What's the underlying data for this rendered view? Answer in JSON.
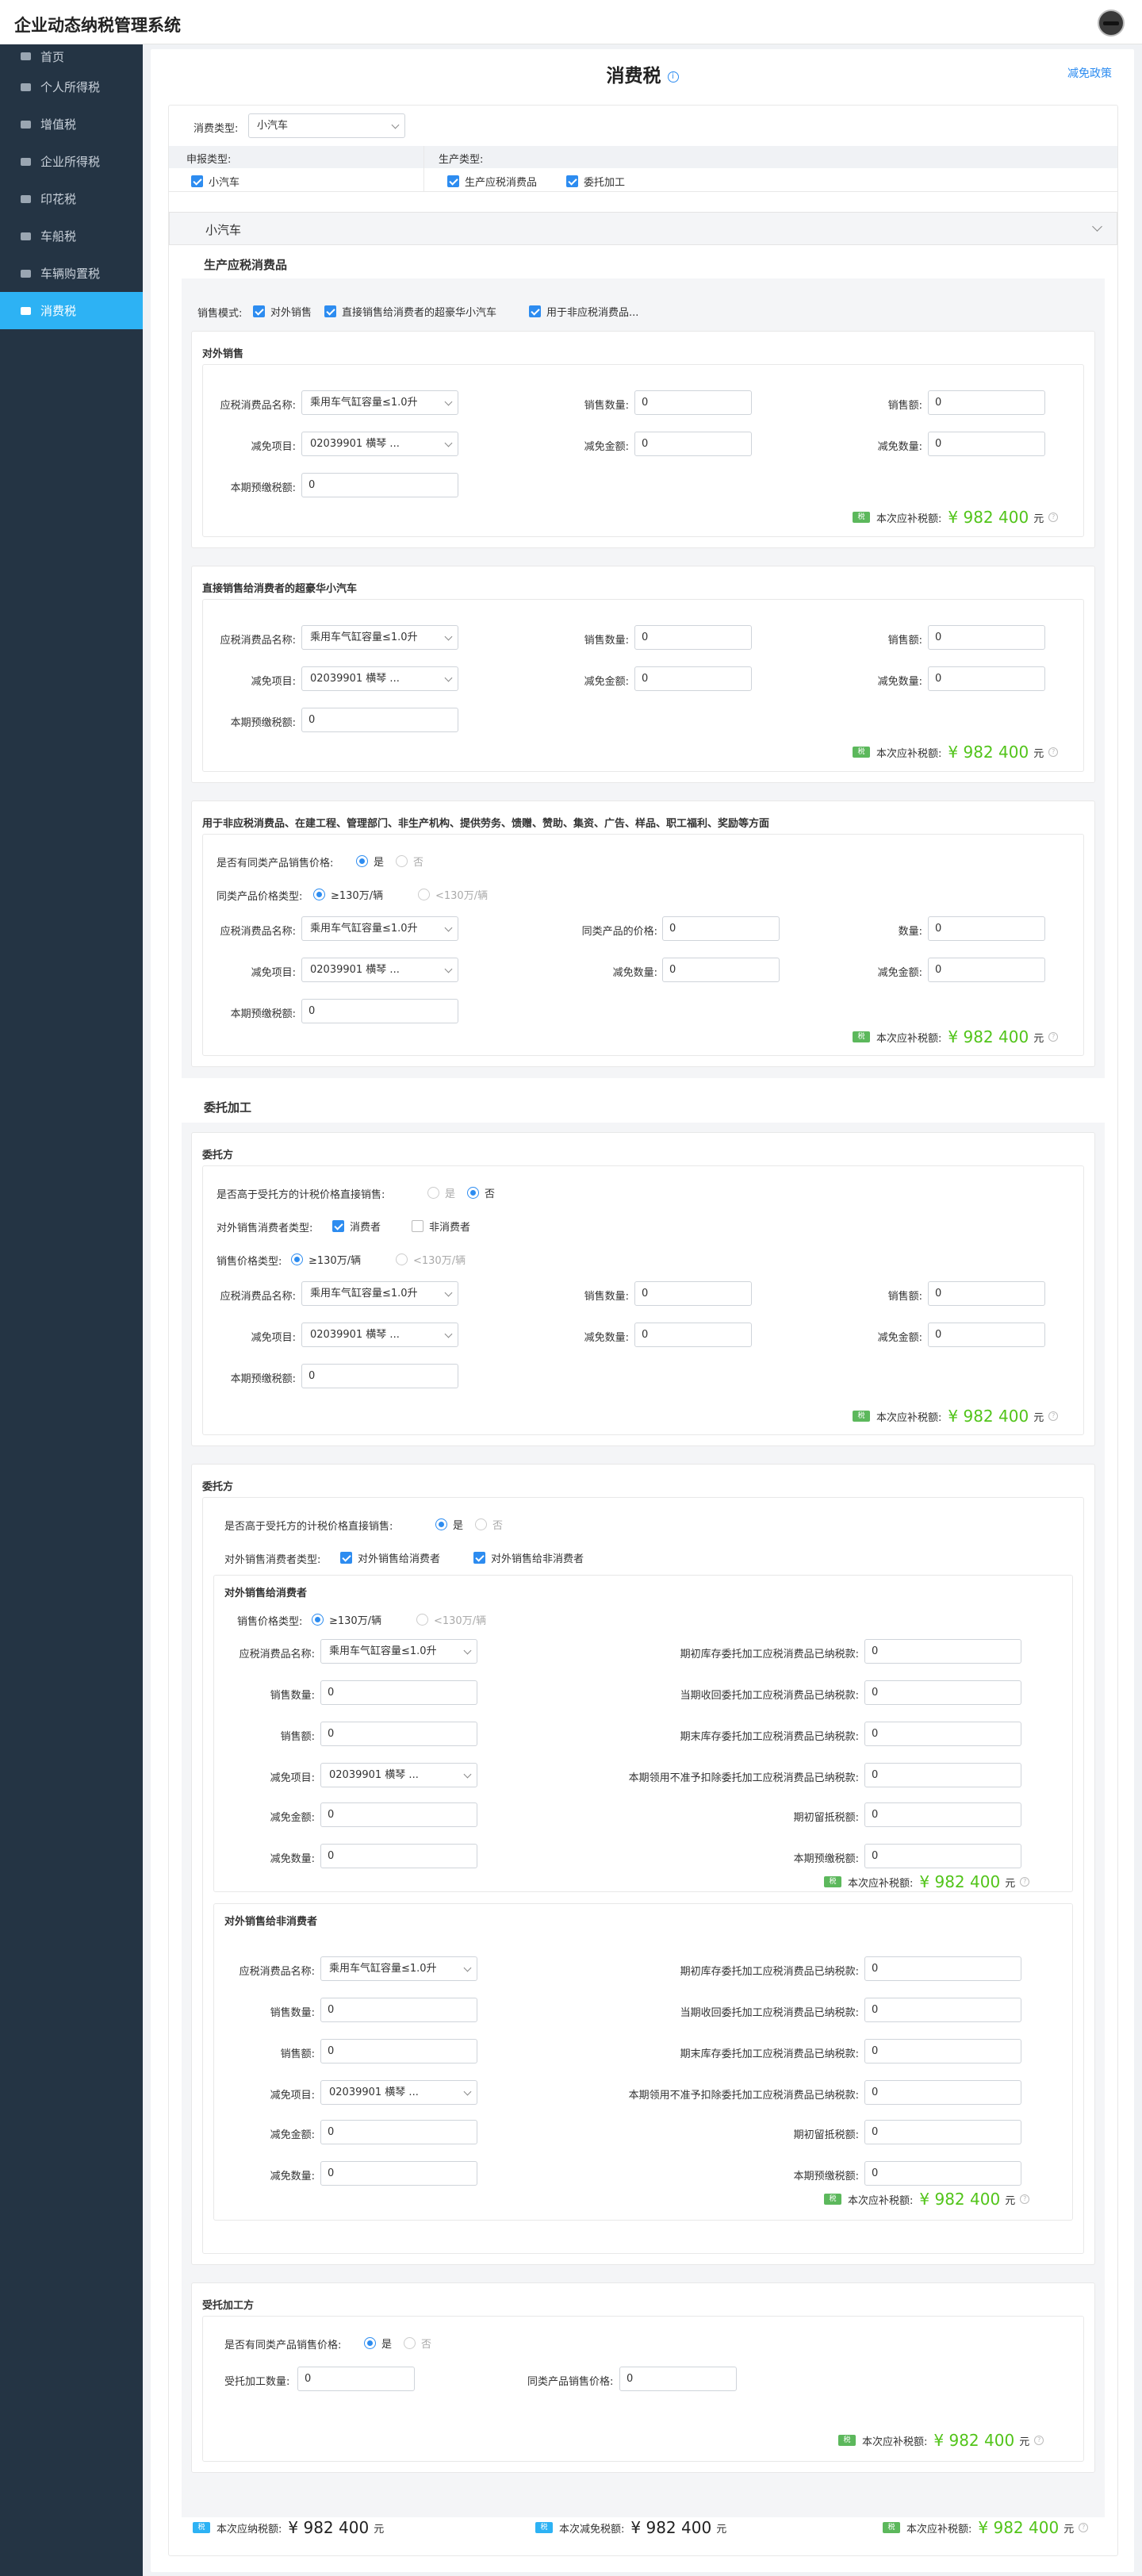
{
  "app": {
    "title": "企业动态纳税管理系统"
  },
  "sidebar": {
    "items": [
      {
        "label": "首页"
      },
      {
        "label": "个人所得税"
      },
      {
        "label": "增值税"
      },
      {
        "label": "企业所得税"
      },
      {
        "label": "印花税"
      },
      {
        "label": "车船税"
      },
      {
        "label": "车辆购置税"
      },
      {
        "label": "消费税"
      }
    ]
  },
  "page": {
    "title": "消费税",
    "policy_link": "减免政策",
    "info_glyph": "i"
  },
  "filter": {
    "type_label": "消费类型:",
    "type_value": "小汽车",
    "declare_header": "申报类型:",
    "produce_header": "生产类型:",
    "declare_option": "小汽车",
    "produce_option1": "生产应税消费品",
    "produce_option2": "委托加工"
  },
  "car_section": {
    "title": "小汽车"
  },
  "production": {
    "title": "生产应税消费品",
    "sales_mode_label": "销售模式:",
    "sales_mode_options": [
      "对外销售",
      "直接销售给消费者的超豪华小汽车",
      "用于非应税消费品..."
    ]
  },
  "labels": {
    "taxable_name": "应税消费品名称:",
    "sales_qty": "销售数量:",
    "sales_amount": "销售额:",
    "reduction_item": "减免项目:",
    "reduction_amount": "减免金额:",
    "reduction_qty": "减免数量:",
    "prepaid": "本期预缴税额:",
    "has_same_price": "是否有同类产品销售价格:",
    "same_price_type": "同类产品价格类型:",
    "same_price": "同类产品的价格:",
    "quantity": "数量:",
    "is_higher": "是否高于受托方的计税价格直接销售:",
    "consumer_type": "对外销售消费者类型:",
    "price_type": "销售价格类型:",
    "opening_stock": "期初库存委托加工应税消费品已纳税款:",
    "current_received": "当期收回委托加工应税消费品已纳税款:",
    "closing_stock": "期末库存委托加工应税消费品已纳税款:",
    "not_deductible": "本期领用不准予扣除委托加工应税消费品已纳税款:",
    "opening_retained": "期初留抵税额:",
    "processing_qty": "受托加工数量:",
    "same_product_price": "同类产品销售价格:",
    "yes": "是",
    "no": "否",
    "consumer": "消费者",
    "non_consumer": "非消费者",
    "ge130": "≥130万/辆",
    "lt130": "<130万/辆",
    "to_consumer": "对外销售给消费者",
    "to_non_consumer": "对外销售给非消费者",
    "tax_payable": "本次应补税额:",
    "yuan": "元",
    "badge": "税",
    "select_product": "乘用车气缸容量≤1.0升",
    "select_reduction": "02039901 横琴 ..."
  },
  "values": {
    "zero": "0",
    "amount": "982 400",
    "yen": "¥"
  },
  "external_sales": {
    "title": "对外销售"
  },
  "luxury": {
    "title": "直接销售给消费者的超豪华小汽车"
  },
  "non_taxable": {
    "title": "用于非应税消费品、在建工程、管理部门、非生产机构、提供劳务、馈赠、赞助、集资、广告、样品、职工福利、奖励等方面"
  },
  "entrusted": {
    "title": "委托加工",
    "principal": "委托方",
    "sub_consumer": "对外销售给消费者",
    "sub_non_consumer": "对外销售给非消费者",
    "processor": "受托加工方"
  },
  "footer": {
    "payable": "本次应纳税额:",
    "reduced": "本次减免税额:",
    "due": "本次应补税额:"
  }
}
